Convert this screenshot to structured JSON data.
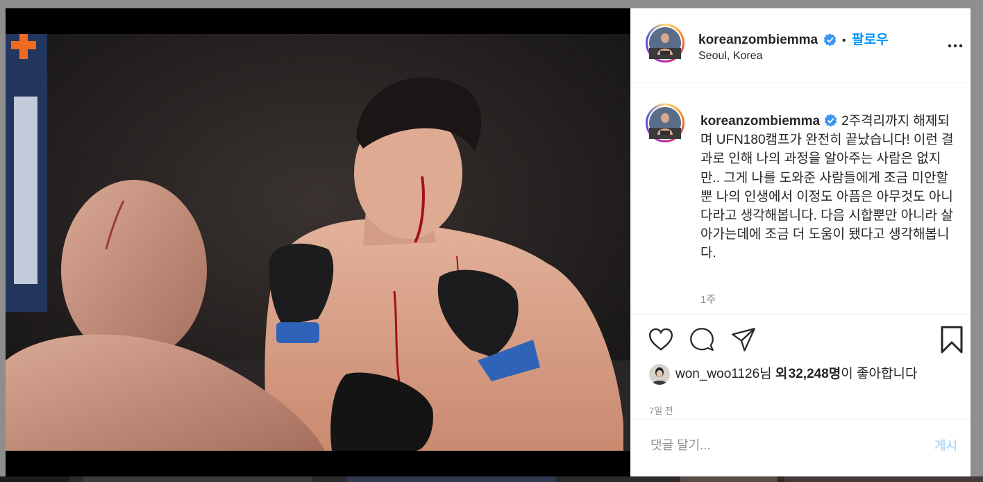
{
  "post": {
    "username": "koreanzombiemma",
    "separator": "•",
    "follow_label": "팔로우",
    "location": "Seoul, Korea",
    "caption": "2주격리까지 해제되며 UFN180캠프가 완전히 끝났습니다! 이런 결과로 인해 나의 과정을 알아주는 사람은 없지만.. 그게 나를 도와준 사람들에게 조금 미안할뿐 나의 인생에서 이정도 아픔은 아무것도 아니다라고 생각해봅니다. 다음 시합뿐만 아니라 살아가는데에 조금 더 도움이 됐다고 생각해봅니다.",
    "caption_time": "1주",
    "likes": {
      "liker": "won_woo1126",
      "suffix_nim": "님",
      "and_label": "외",
      "count": "32,248명",
      "tail": "이 좋아합니다"
    },
    "date": "7일 전",
    "comment_placeholder": "댓글 달기...",
    "post_label": "게시"
  },
  "icons": {
    "more": "more-options-icon",
    "like": "heart-icon",
    "comment": "comment-icon",
    "share": "share-icon",
    "save": "bookmark-icon",
    "verified": "verified-badge-icon"
  },
  "colors": {
    "link_blue": "#0095f6",
    "verified_blue": "#3897f0",
    "muted": "#8e8e8e",
    "post_disabled": "#b3dbff"
  }
}
